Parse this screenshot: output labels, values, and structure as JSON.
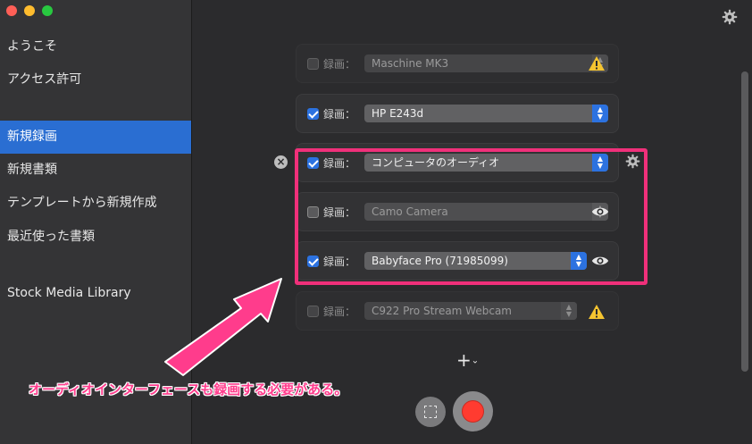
{
  "sidebar": {
    "items": [
      {
        "label": "ようこそ"
      },
      {
        "label": "アクセス許可"
      },
      {
        "label": "新規録画"
      },
      {
        "label": "新規書類"
      },
      {
        "label": "テンプレートから新規作成"
      },
      {
        "label": "最近使った書類"
      },
      {
        "label": "Stock Media Library"
      }
    ]
  },
  "sources": [
    {
      "label": "録画：",
      "device": "Maschine MK3",
      "checked": false,
      "enabled": false,
      "status_icon": "warning-icon"
    },
    {
      "label": "録画：",
      "device": "HP E243d",
      "checked": true,
      "enabled": true,
      "status_icon": ""
    },
    {
      "label": "録画：",
      "device": "コンピュータのオーディオ",
      "checked": true,
      "enabled": true,
      "status_icon": "gear-icon"
    },
    {
      "label": "録画：",
      "device": "Camo Camera",
      "checked": false,
      "enabled": true,
      "status_icon": "eye-icon"
    },
    {
      "label": "録画：",
      "device": "Babyface Pro (71985099)",
      "checked": true,
      "enabled": true,
      "status_icon": "eye-icon"
    },
    {
      "label": "録画：",
      "device": "C922 Pro Stream Webcam",
      "checked": false,
      "enabled": false,
      "status_icon": "warning-icon"
    }
  ],
  "add_button": {
    "label": "+",
    "chevron": "⌄"
  },
  "annotation": {
    "text": "オーディオインターフェースも録画する必要がある。"
  },
  "colors": {
    "accent": "#2c72e0",
    "highlight": "#f0307a",
    "record": "#ff3b30",
    "warning": "#f4c430"
  }
}
